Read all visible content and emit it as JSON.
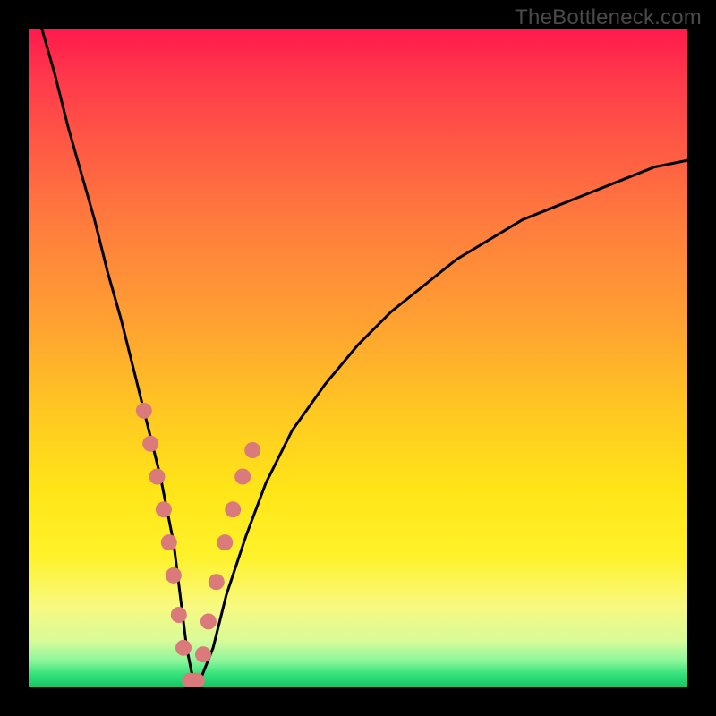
{
  "watermark": "TheBottleneck.com",
  "colors": {
    "frame": "#000000",
    "gradient_top": "#ff1a4d",
    "gradient_bottom": "#18c466",
    "curve": "#000000",
    "dots": "#db7a7a"
  },
  "chart_data": {
    "type": "line",
    "title": "",
    "xlabel": "",
    "ylabel": "",
    "xlim": [
      0,
      100
    ],
    "ylim": [
      0,
      100
    ],
    "annotations": [
      "TheBottleneck.com"
    ],
    "series": [
      {
        "name": "bottleneck-curve",
        "x": [
          2,
          4,
          6,
          8,
          10,
          12,
          14,
          16,
          18,
          20,
          22,
          23,
          24,
          25,
          26,
          28,
          30,
          33,
          36,
          40,
          45,
          50,
          55,
          60,
          65,
          70,
          75,
          80,
          85,
          90,
          95,
          100
        ],
        "y": [
          100,
          93,
          85,
          78,
          71,
          63,
          56,
          48,
          40,
          32,
          22,
          14,
          6,
          1,
          1,
          6,
          14,
          23,
          31,
          39,
          46,
          52,
          57,
          61,
          65,
          68,
          71,
          73,
          75,
          77,
          79,
          80
        ]
      }
    ],
    "marker_points": {
      "name": "highlighted-points",
      "x": [
        17.5,
        18.5,
        19.5,
        20.5,
        21.3,
        22.0,
        22.8,
        23.5,
        24.5,
        25.5,
        26.5,
        27.3,
        28.5,
        29.8,
        31.0,
        32.5,
        34.0
      ],
      "y": [
        42,
        37,
        32,
        27,
        22,
        17,
        11,
        6,
        1,
        1,
        5,
        10,
        16,
        22,
        27,
        32,
        36
      ]
    }
  }
}
